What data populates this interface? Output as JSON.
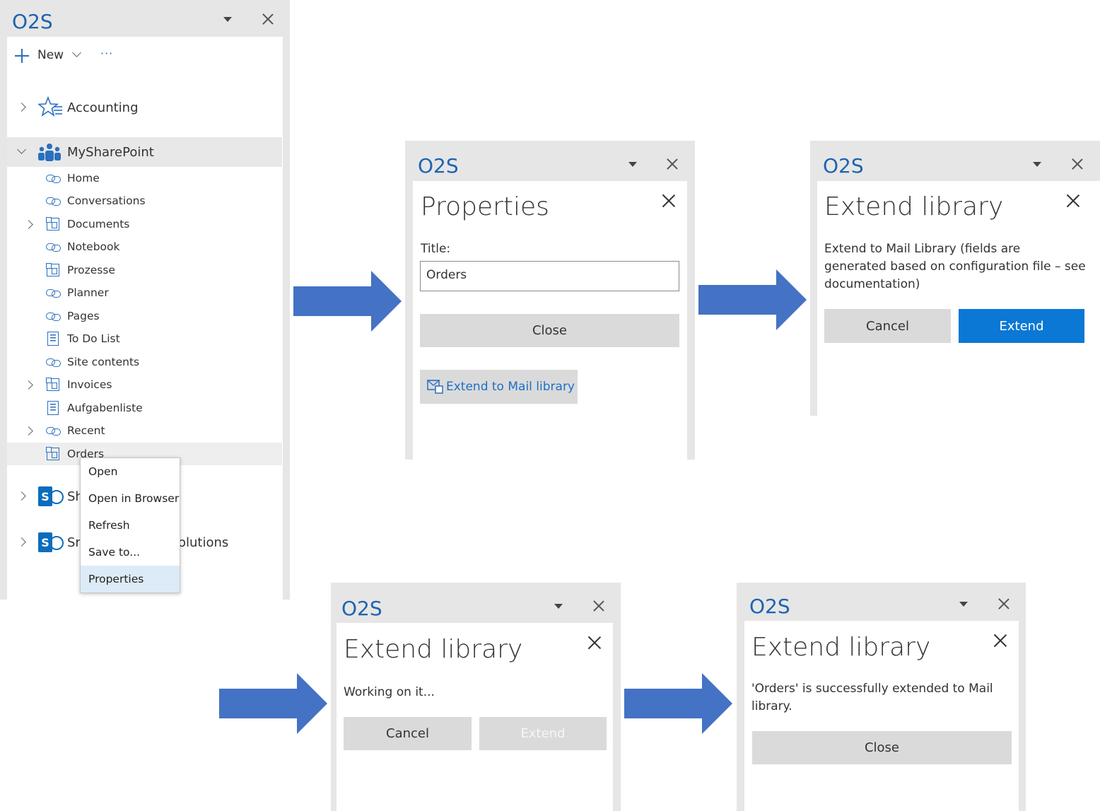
{
  "app_title": "O2S",
  "panel": {
    "new_label": "New",
    "more_label": "···",
    "sites": [
      {
        "label": "Accounting"
      },
      {
        "label": "MySharePoint"
      },
      {
        "label": "Sh"
      },
      {
        "label": "Sr"
      }
    ],
    "obscured_text": "olutions",
    "items": [
      {
        "label": "Home",
        "icon": "link-icon",
        "expandable": false
      },
      {
        "label": "Conversations",
        "icon": "link-icon",
        "expandable": false
      },
      {
        "label": "Documents",
        "icon": "library-icon",
        "expandable": true
      },
      {
        "label": "Notebook",
        "icon": "link-icon",
        "expandable": false
      },
      {
        "label": "Prozesse",
        "icon": "library-icon",
        "expandable": false
      },
      {
        "label": "Planner",
        "icon": "link-icon",
        "expandable": false
      },
      {
        "label": "Pages",
        "icon": "link-icon",
        "expandable": false
      },
      {
        "label": "To Do List",
        "icon": "list-icon",
        "expandable": false
      },
      {
        "label": "Site contents",
        "icon": "link-icon",
        "expandable": false
      },
      {
        "label": "Invoices",
        "icon": "library-icon",
        "expandable": true
      },
      {
        "label": "Aufgabenliste",
        "icon": "list-icon",
        "expandable": false
      },
      {
        "label": "Recent",
        "icon": "link-icon",
        "expandable": true
      },
      {
        "label": "Orders",
        "icon": "library-icon",
        "expandable": false
      }
    ],
    "context_menu": [
      "Open",
      "Open in Browser",
      "Refresh",
      "Save to...",
      "Properties"
    ]
  },
  "properties_dialog": {
    "title": "Properties",
    "field_label": "Title:",
    "field_value": "Orders",
    "close_label": "Close",
    "extend_link": "Extend to Mail library"
  },
  "extend_confirm": {
    "title": "Extend library",
    "message": "Extend to Mail Library (fields are generated based on configuration file – see documentation)",
    "cancel_label": "Cancel",
    "extend_label": "Extend"
  },
  "extend_working": {
    "title": "Extend library",
    "message": "Working on it...",
    "cancel_label": "Cancel",
    "extend_label": "Extend"
  },
  "extend_done": {
    "title": "Extend library",
    "message": "'Orders' is successfully extended to Mail library.",
    "close_label": "Close"
  },
  "colors": {
    "accent": "#0a78d4",
    "brand_blue": "#1e63b0",
    "arrow_blue": "#4472c4",
    "pane_gray": "#e6e6e6",
    "button_gray": "#dadada",
    "menu_highlight": "#dcebf7"
  }
}
